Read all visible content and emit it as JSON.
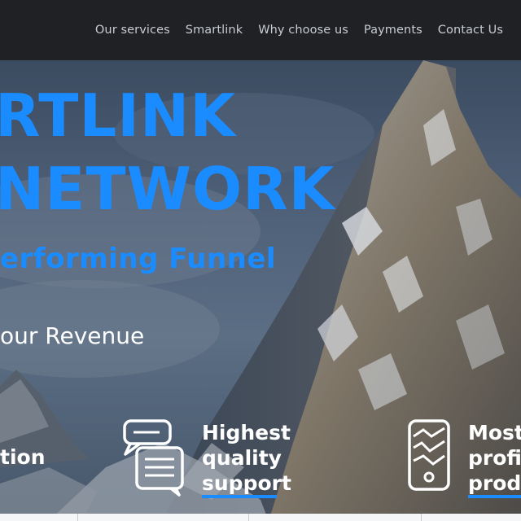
{
  "nav": {
    "items": [
      "Our services",
      "Smartlink",
      "Why choose us",
      "Payments",
      "Contact Us"
    ]
  },
  "hero": {
    "line1": "RTLINK",
    "line2": "NETWORK",
    "tagline": "erforming Funnel",
    "subline": "our Revenue"
  },
  "features": {
    "left": "tion",
    "middle": [
      "Highest",
      "quality",
      "support"
    ],
    "right": [
      "Most",
      "profi",
      "produ"
    ]
  },
  "colors": {
    "accent": "#1a8cff",
    "navbar": "#1f2125",
    "nav_text": "#c9ccd1"
  },
  "icons": {
    "chat": "chat-bubbles-icon",
    "phone": "phone-chart-icon"
  }
}
